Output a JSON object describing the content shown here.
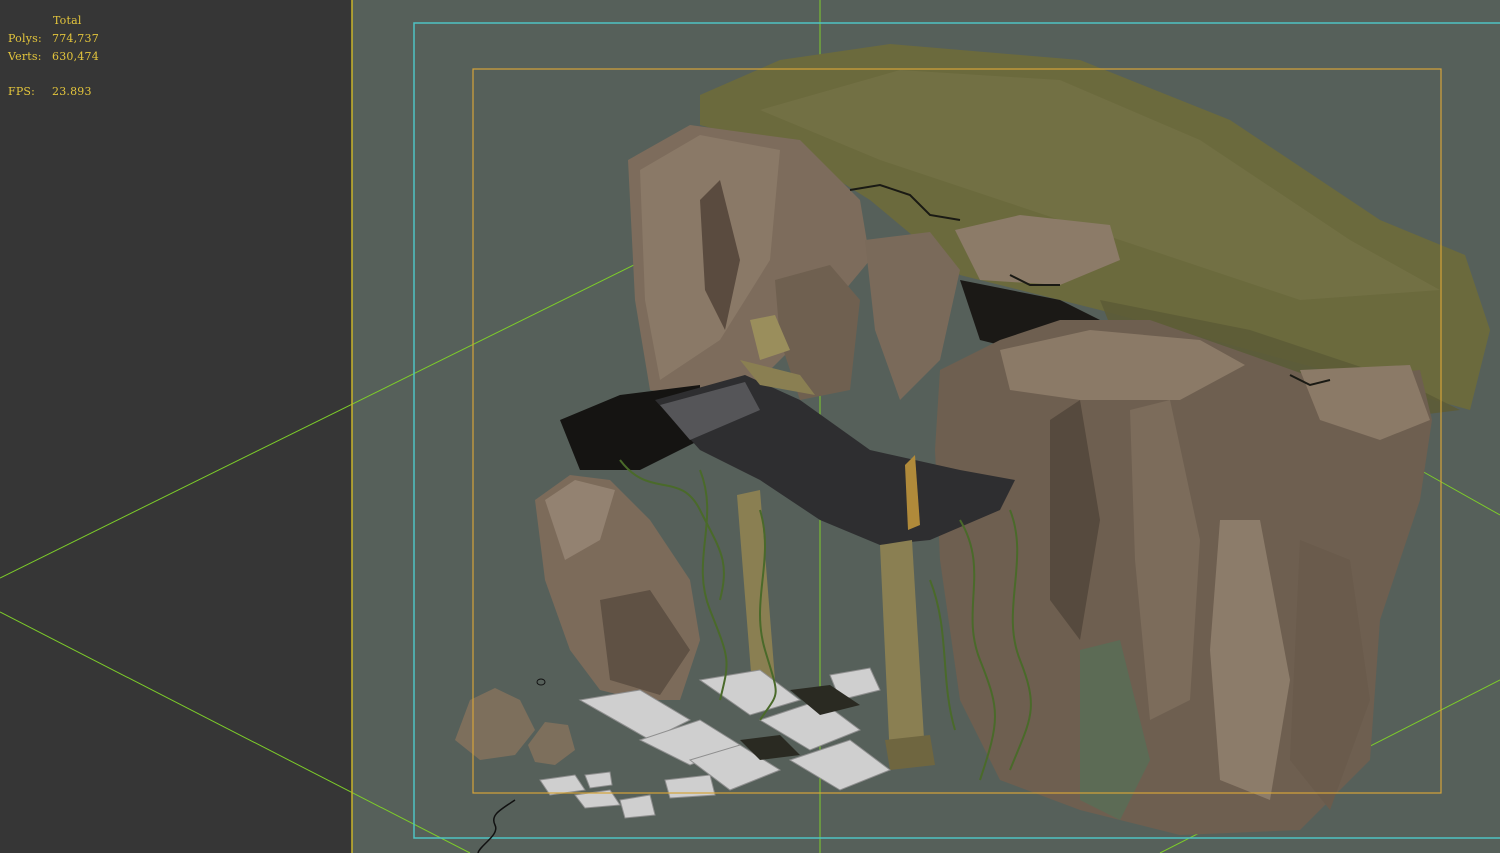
{
  "viewport": {
    "background_left": "#363636",
    "background_right": "#56605a",
    "frame_color": "#4fc3c3",
    "safe_frame_color": "#d4a43a",
    "divider_color": "#c8b42a",
    "grid_line_color": "#7dcc2a"
  },
  "stats": {
    "color": "#e3c53c",
    "title": "Total",
    "polys_label": "Polys:",
    "polys_value": "774,737",
    "verts_label": "Verts:",
    "verts_value": "630,474",
    "fps_label": "FPS:",
    "fps_value": "23.893"
  },
  "scene": {
    "moss_color": "#6b6a3d",
    "rock_color": "#7a6a5a",
    "rock_dark": "#4a3f36",
    "roof_color": "#2e2e30",
    "pillar_color": "#8a7f52",
    "floor_tile_color": "#cfcfcf",
    "vine_color": "#4a6a2a"
  }
}
